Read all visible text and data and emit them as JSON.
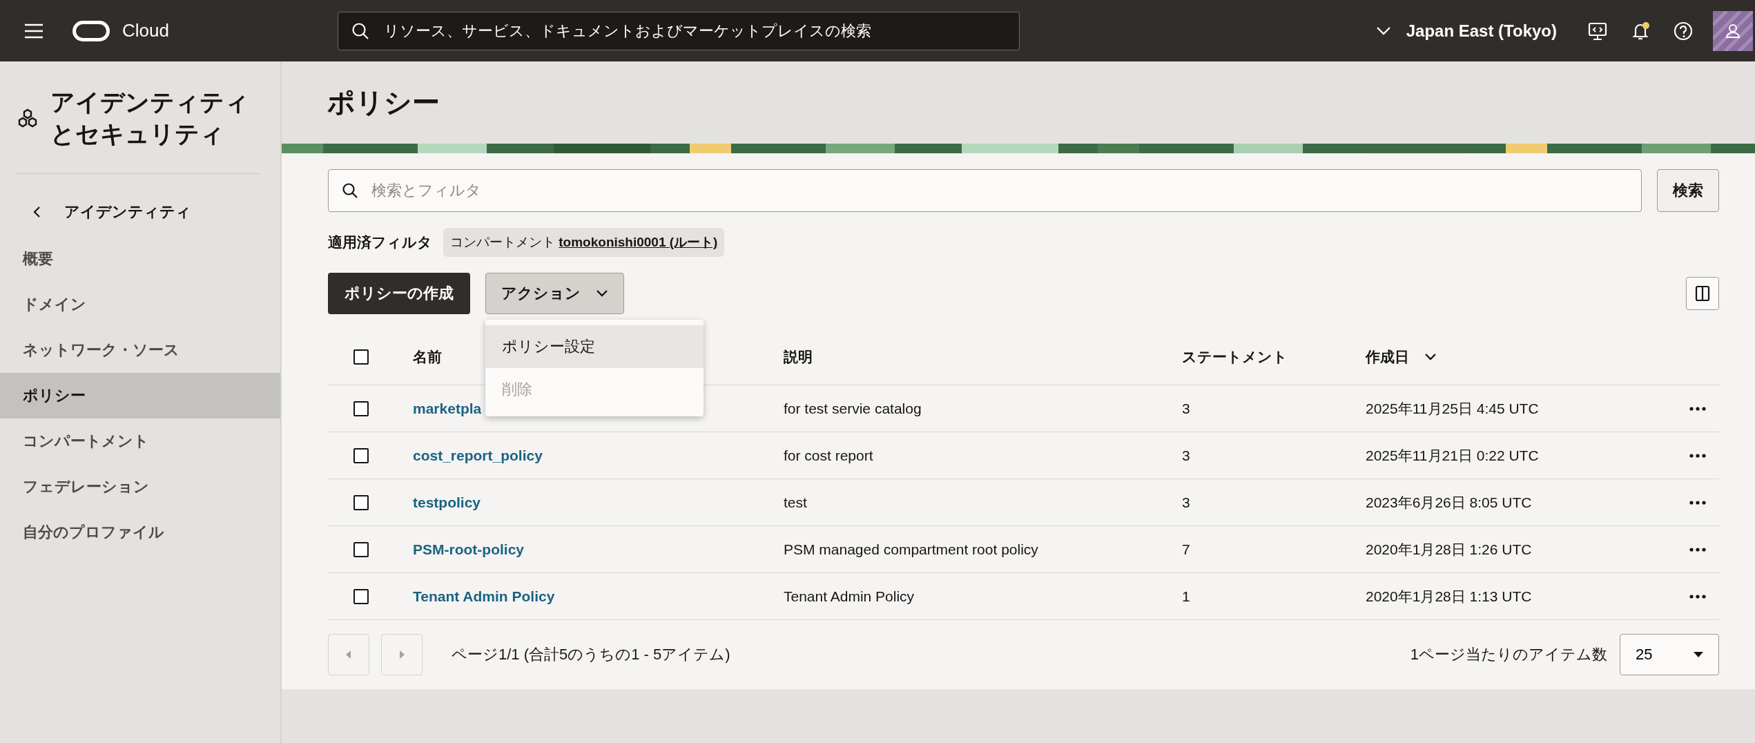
{
  "top_bar": {
    "logo_text": "Cloud",
    "search": {
      "placeholder": "リソース、サービス、ドキュメントおよびマーケットプレイスの検索"
    },
    "region": "Japan East (Tokyo)",
    "notification_dot": true
  },
  "sidebar": {
    "title": "アイデンティティとセキュリティ",
    "back_link": "アイデンティティ",
    "items": [
      {
        "label": "概要",
        "selected": false
      },
      {
        "label": "ドメイン",
        "selected": false
      },
      {
        "label": "ネットワーク・ソース",
        "selected": false
      },
      {
        "label": "ポリシー",
        "selected": true
      },
      {
        "label": "コンパートメント",
        "selected": false
      },
      {
        "label": "フェデレーション",
        "selected": false
      },
      {
        "label": "自分のプロファイル",
        "selected": false
      }
    ]
  },
  "page": {
    "title": "ポリシー",
    "search": {
      "placeholder": "検索とフィルタ",
      "button": "検索"
    },
    "applied_filters": {
      "label": "適用済フィルタ",
      "chip_label": "コンパートメント",
      "chip_value": "tomokonishi0001 (ルート)"
    },
    "create_button": "ポリシーの作成",
    "actions_button": "アクション",
    "actions_menu": [
      {
        "label": "ポリシー設定",
        "highlighted": true,
        "disabled": false
      },
      {
        "label": "削除",
        "highlighted": false,
        "disabled": true
      }
    ],
    "table": {
      "columns": [
        {
          "label": "名前",
          "sorted": false
        },
        {
          "label": "説明",
          "sorted": false
        },
        {
          "label": "ステートメント",
          "sorted": false
        },
        {
          "label": "作成日",
          "sorted": true
        }
      ],
      "all_checked": false,
      "rows": [
        {
          "checked": false,
          "name": "marketpla",
          "description": "for test servie catalog",
          "statements": "3",
          "created": "2025年11月25日 4:45 UTC"
        },
        {
          "checked": false,
          "name": "cost_report_policy",
          "description": "for cost report",
          "statements": "3",
          "created": "2025年11月21日 0:22 UTC"
        },
        {
          "checked": false,
          "name": "testpolicy",
          "description": "test",
          "statements": "3",
          "created": "2023年6月26日 8:05 UTC"
        },
        {
          "checked": false,
          "name": "PSM-root-policy",
          "description": "PSM managed compartment root policy",
          "statements": "7",
          "created": "2020年1月28日 1:26 UTC"
        },
        {
          "checked": false,
          "name": "Tenant Admin Policy",
          "description": "Tenant Admin Policy",
          "statements": "1",
          "created": "2020年1月28日 1:13 UTC"
        }
      ]
    },
    "pagination": {
      "summary": "ページ1/1 (合計5のうちの1 - 5アイテム)",
      "per_page_label": "1ページ当たりのアイテム数",
      "per_page": "25"
    }
  }
}
